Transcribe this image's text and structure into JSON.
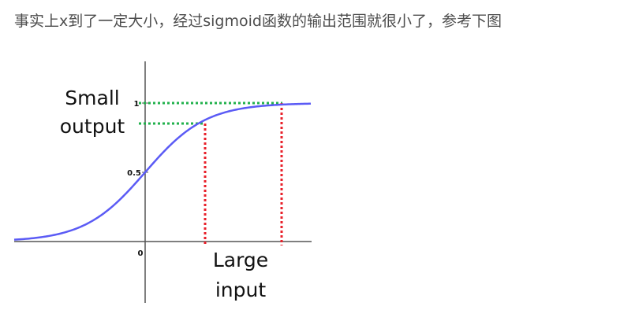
{
  "caption": "事实上x到了一定大小，经过sigmoid函数的输出范围就很小了，参考下图",
  "diagram": {
    "annotation_output": [
      "Small",
      "output"
    ],
    "annotation_input": [
      "Large",
      "input"
    ],
    "tick_y_one": "1",
    "tick_y_half": "0.5",
    "origin_label": "0",
    "colors": {
      "curve": "#5b5bf5",
      "axis": "#555555",
      "horizontal_guides": "#22b14c",
      "vertical_guides": "#e8202a"
    }
  }
}
